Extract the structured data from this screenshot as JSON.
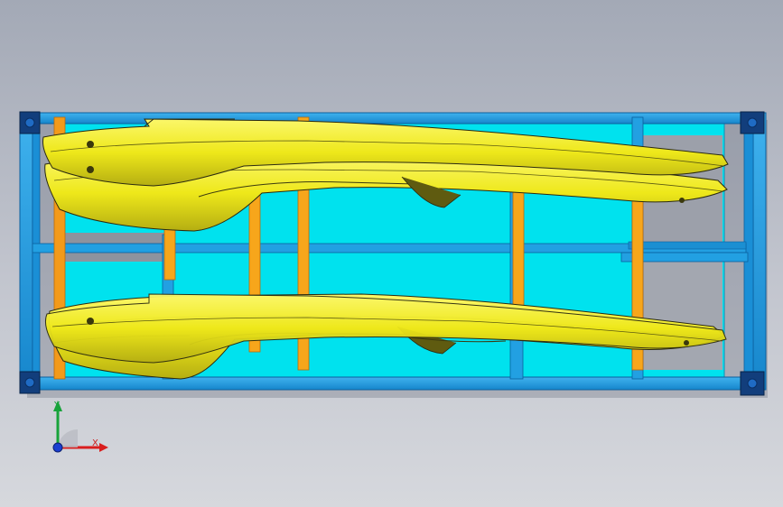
{
  "viewport": {
    "background_top": "#a3a9b6",
    "background_bottom": "#d6d8dd"
  },
  "model": {
    "frame_color": "#1f9be0",
    "frame_dark": "#0b5f9e",
    "plate_color": "#00e4f0",
    "support_color": "#f7a61b",
    "rail_color": "#f1ec1a",
    "rail_shadow": "#b7b414",
    "corner_pad_color": "#103c7a"
  },
  "triad": {
    "x_label": "X",
    "y_label": "Y",
    "x_color": "#d91e1e",
    "y_color": "#17a33a",
    "z_color": "#1a3fd1",
    "icons": [
      "x-axis-arrow-icon",
      "y-axis-arrow-icon",
      "z-axis-origin-icon"
    ]
  }
}
